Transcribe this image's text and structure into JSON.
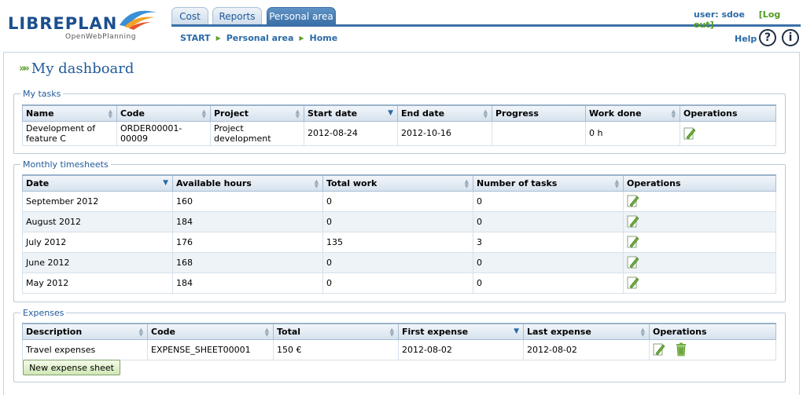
{
  "header": {
    "logo_text": "LIBREPLAN",
    "logo_tagline": "OpenWebPlanning",
    "tabs": [
      {
        "label": "Cost"
      },
      {
        "label": "Reports"
      },
      {
        "label": "Personal area",
        "active": true
      }
    ],
    "breadcrumb": [
      "START",
      "Personal area",
      "Home"
    ],
    "user_label": "user: sdoe",
    "logout_label": "[Log out]",
    "help_label": "Help",
    "help_icon": "question-icon",
    "info_icon": "info-icon"
  },
  "page_title": "My dashboard",
  "tasks": {
    "legend": "My tasks",
    "columns": [
      "Name",
      "Code",
      "Project",
      "Start date",
      "End date",
      "Progress",
      "Work done",
      "Operations"
    ],
    "rows": [
      {
        "name": "Development of feature C",
        "code": "ORDER00001-00009",
        "project": "Project development",
        "start_date": "2012-08-24",
        "end_date": "2012-10-16",
        "progress": "",
        "work_done": "0 h"
      }
    ]
  },
  "timesheets": {
    "legend": "Monthly timesheets",
    "columns": [
      "Date",
      "Available hours",
      "Total work",
      "Number of tasks",
      "Operations"
    ],
    "rows": [
      {
        "date": "September 2012",
        "available_hours": "160",
        "total_work": "0",
        "number_of_tasks": "0"
      },
      {
        "date": "August 2012",
        "available_hours": "184",
        "total_work": "0",
        "number_of_tasks": "0"
      },
      {
        "date": "July 2012",
        "available_hours": "176",
        "total_work": "135",
        "number_of_tasks": "3"
      },
      {
        "date": "June 2012",
        "available_hours": "168",
        "total_work": "0",
        "number_of_tasks": "0"
      },
      {
        "date": "May 2012",
        "available_hours": "184",
        "total_work": "0",
        "number_of_tasks": "0"
      }
    ]
  },
  "expenses": {
    "legend": "Expenses",
    "columns": [
      "Description",
      "Code",
      "Total",
      "First expense",
      "Last expense",
      "Operations"
    ],
    "rows": [
      {
        "description": "Travel expenses",
        "code": "EXPENSE_SHEET00001",
        "total": "150 €",
        "first_expense": "2012-08-02",
        "last_expense": "2012-08-02"
      }
    ],
    "new_button_label": "New expense sheet"
  },
  "icons": {
    "edit": "edit-icon",
    "delete": "trash-icon",
    "sort": "sort-icon"
  },
  "colors": {
    "accent_blue": "#1f5a9a",
    "tab_active": "#3b70a8",
    "accent_green": "#5aa02c"
  }
}
